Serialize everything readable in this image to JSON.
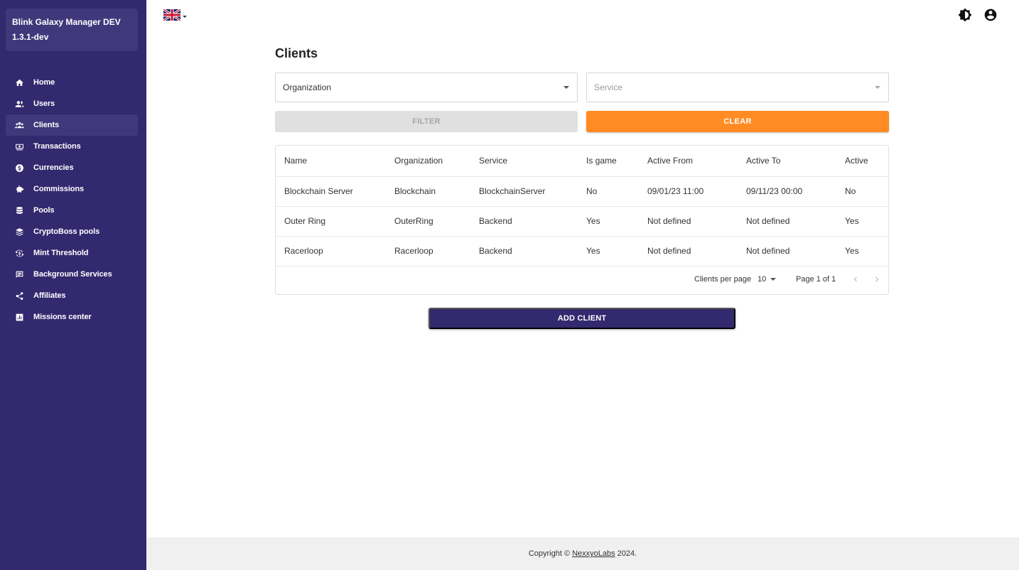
{
  "app": {
    "title": "Blink Galaxy Manager DEV 1.3.1-dev"
  },
  "sidebar": {
    "items": [
      {
        "label": "Home",
        "icon": "home-icon"
      },
      {
        "label": "Users",
        "icon": "users-icon"
      },
      {
        "label": "Clients",
        "icon": "clients-icon",
        "active": true
      },
      {
        "label": "Transactions",
        "icon": "transactions-icon"
      },
      {
        "label": "Currencies",
        "icon": "currency-icon"
      },
      {
        "label": "Commissions",
        "icon": "piggy-bank-icon"
      },
      {
        "label": "Pools",
        "icon": "database-icon"
      },
      {
        "label": "CryptoBoss pools",
        "icon": "layers-icon"
      },
      {
        "label": "Mint Threshold",
        "icon": "refresh-currency-icon"
      },
      {
        "label": "Background Services",
        "icon": "list-icon"
      },
      {
        "label": "Affiliates",
        "icon": "share-icon"
      },
      {
        "label": "Missions center",
        "icon": "chart-box-icon"
      }
    ]
  },
  "topbar": {
    "language_icon": "uk-flag-icon",
    "theme_icon": "brightness-icon",
    "account_icon": "account-circle-icon"
  },
  "page": {
    "title": "Clients",
    "filters": {
      "organization_value": "Organization",
      "service_placeholder": "Service"
    },
    "buttons": {
      "filter": "FILTER",
      "clear": "CLEAR",
      "add_client": "ADD CLIENT"
    }
  },
  "table": {
    "columns": [
      "Name",
      "Organization",
      "Service",
      "Is game",
      "Active From",
      "Active To",
      "Active"
    ],
    "rows": [
      [
        "Blockchain Server",
        "Blockchain",
        "BlockchainServer",
        "No",
        "09/01/23 11:00",
        "09/11/23 00:00",
        "No"
      ],
      [
        "Outer Ring",
        "OuterRing",
        "Backend",
        "Yes",
        "Not defined",
        "Not defined",
        "Yes"
      ],
      [
        "Racerloop",
        "Racerloop",
        "Backend",
        "Yes",
        "Not defined",
        "Not defined",
        "Yes"
      ]
    ],
    "pagination": {
      "per_page_label": "Clients per page",
      "per_page_value": "10",
      "page_info": "Page 1 of 1"
    }
  },
  "footer": {
    "prefix": "Copyright ©",
    "link": "NexxyoLabs",
    "suffix": "2024."
  },
  "colors": {
    "sidebar": "#33296e",
    "accent": "#ff8b22",
    "primary": "#33296e"
  }
}
